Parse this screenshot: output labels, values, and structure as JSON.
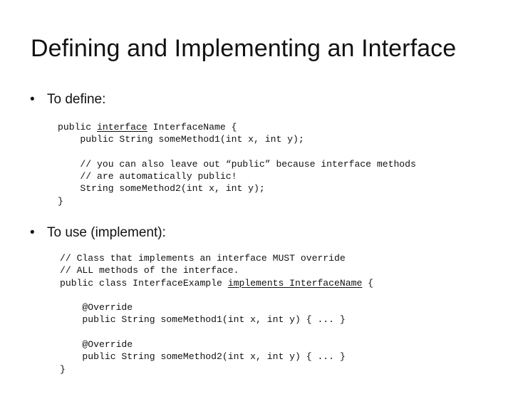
{
  "slide": {
    "title": "Defining and Implementing an Interface",
    "bullet_glyph": "•"
  },
  "section_define": {
    "label": "To define:",
    "code": [
      [
        "public ",
        {
          "u": "interface"
        },
        " InterfaceName {"
      ],
      [
        "    public String someMethod1(int x, int y);"
      ],
      [
        ""
      ],
      [
        "    // you can also leave out “public” because interface methods"
      ],
      [
        "    // are automatically public!"
      ],
      [
        "    String someMethod2(int x, int y);"
      ],
      [
        "}"
      ]
    ]
  },
  "section_implement": {
    "label": "To use (implement):",
    "code": [
      [
        "// Class that implements an interface MUST override"
      ],
      [
        "// ALL methods of the interface."
      ],
      [
        "public class InterfaceExample ",
        {
          "u": "implements InterfaceName"
        },
        " {"
      ],
      [
        ""
      ],
      [
        "    @Override"
      ],
      [
        "    public String someMethod1(int x, int y) { ... }"
      ],
      [
        ""
      ],
      [
        "    @Override"
      ],
      [
        "    public String someMethod2(int x, int y) { ... }"
      ],
      [
        "}"
      ]
    ]
  }
}
